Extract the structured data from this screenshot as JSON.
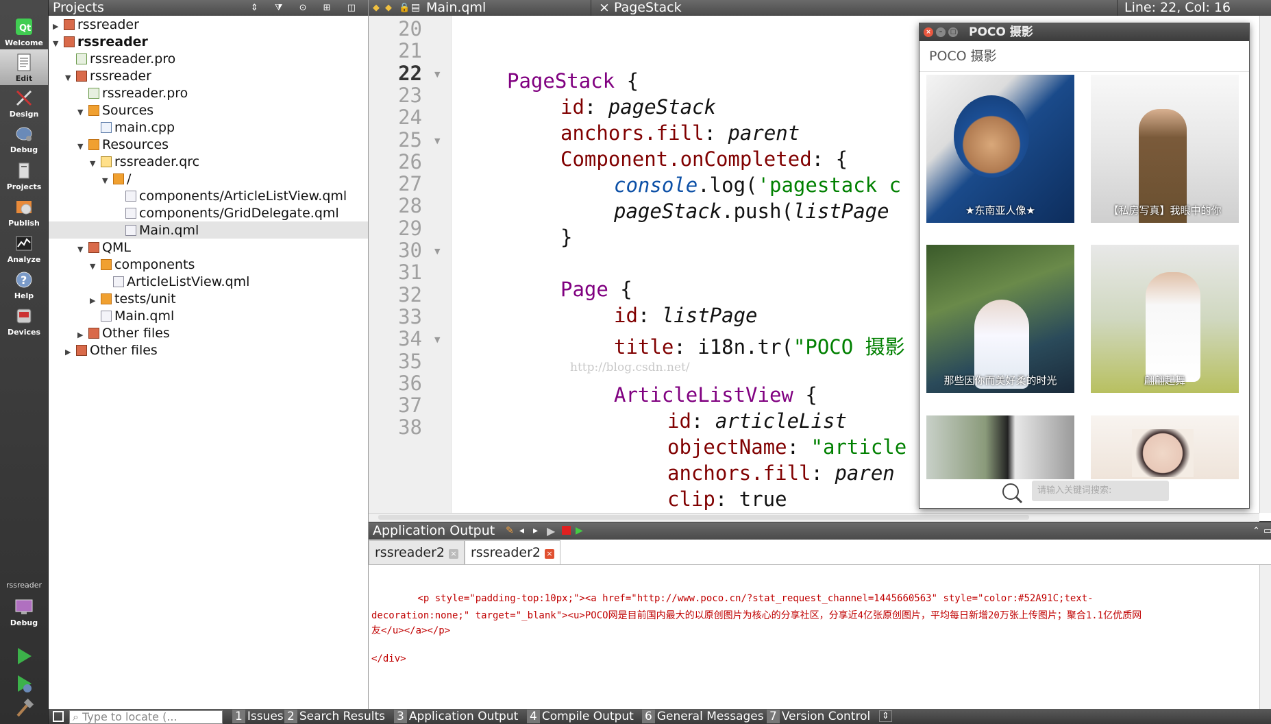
{
  "mode_bar": {
    "items": [
      {
        "label": "Welcome",
        "icon": "qt-logo-icon"
      },
      {
        "label": "Edit",
        "icon": "edit-icon"
      },
      {
        "label": "Design",
        "icon": "design-icon"
      },
      {
        "label": "Debug",
        "icon": "debug-icon"
      },
      {
        "label": "Projects",
        "icon": "projects-icon"
      },
      {
        "label": "Publish",
        "icon": "publish-icon"
      },
      {
        "label": "Analyze",
        "icon": "analyze-icon"
      },
      {
        "label": "Help",
        "icon": "help-icon"
      },
      {
        "label": "Devices",
        "icon": "devices-icon"
      }
    ],
    "target_project": "rssreader",
    "target_mode": "Debug"
  },
  "projects_pane": {
    "title": "Projects",
    "tree": [
      {
        "label": "rssreader",
        "type": "proj"
      },
      {
        "label": "rssreader",
        "type": "proj"
      },
      {
        "label": "rssreader.pro",
        "type": "pro"
      },
      {
        "label": "rssreader",
        "type": "proj"
      },
      {
        "label": "rssreader.pro",
        "type": "pro"
      },
      {
        "label": "Sources",
        "type": "folder"
      },
      {
        "label": "main.cpp",
        "type": "cpp"
      },
      {
        "label": "Resources",
        "type": "folder"
      },
      {
        "label": "rssreader.qrc",
        "type": "res"
      },
      {
        "label": "/",
        "type": "folder"
      },
      {
        "label": "components/ArticleListView.qml",
        "type": "qml"
      },
      {
        "label": "components/GridDelegate.qml",
        "type": "qml"
      },
      {
        "label": "Main.qml",
        "type": "qml"
      },
      {
        "label": "QML",
        "type": "proj"
      },
      {
        "label": "components",
        "type": "folder"
      },
      {
        "label": "ArticleListView.qml",
        "type": "qml"
      },
      {
        "label": "tests/unit",
        "type": "folder"
      },
      {
        "label": "Main.qml",
        "type": "qml"
      },
      {
        "label": "Other files",
        "type": "proj"
      },
      {
        "label": "Other files",
        "type": "proj"
      }
    ]
  },
  "editor": {
    "file_name": "Main.qml",
    "symbol": "PageStack",
    "cursor": "Line: 22, Col: 16",
    "line_numbers": [
      "20",
      "21",
      "22",
      "23",
      "24",
      "25",
      "26",
      "27",
      "28",
      "29",
      "30",
      "31",
      "32",
      "33",
      "34",
      "35",
      "36",
      "37",
      "38"
    ],
    "code": {
      "l22_kw": "PageStack",
      "l22_rest": " {",
      "l23_prop": "id",
      "l23_val": "pageStack",
      "l24_prop": "anchors.fill",
      "l24_val": "parent",
      "l25_prop": "Component.onCompleted",
      "l25_rest": ": {",
      "l26_obj": "console",
      "l26_call": ".log(",
      "l26_str": "'pagestack c",
      "l27_val": "pageStack",
      "l27_call": ".push(",
      "l27_arg": "listPage",
      "l28": "}",
      "l30_kw": "Page",
      "l30_rest": " {",
      "l31_prop": "id",
      "l31_val": "listPage",
      "l32_prop": "title",
      "l32_call": ": i18n.tr(",
      "l32_str": "\"POCO 摄影",
      "l33_watermark": "http://blog.csdn.net/",
      "l34_kw": "ArticleListView",
      "l34_rest": " {",
      "l35_prop": "id",
      "l35_val": "articleList",
      "l36_prop": "objectName",
      "l36_str": "\"article",
      "l37_prop": "anchors.fill",
      "l37_val": "paren",
      "l38_prop": "clip",
      "l38_val": "true",
      "colon": ": "
    }
  },
  "poco_window": {
    "title": "POCO 摄影",
    "header": "POCO 摄影",
    "tiles": [
      {
        "caption": "★东南亚人像★"
      },
      {
        "caption": "【私房写真】我眼中的你"
      },
      {
        "caption": "那些因你而美好柔的时光"
      },
      {
        "caption": "翩翩起舞"
      },
      {
        "caption": ""
      },
      {
        "caption": ""
      }
    ],
    "search_placeholder": "请输入关键词搜索:"
  },
  "output": {
    "title": "Application Output",
    "tabs": [
      {
        "label": "rssreader2"
      },
      {
        "label": "rssreader2"
      }
    ],
    "lines": [
      "        <p style=\"padding-top:10px;\"><a href=\"http://www.poco.cn/?stat_request_channel=1445660563\" style=\"color:#52A91C;text-",
      "decoration:none;\" target=\"_blank\"><u>POCO网是目前国内最大的以原创图片为核心的分享社区，分享近4亿张原创图片，平均每日新增20万张上传图片；聚合1.1亿优质网",
      "友</u></a></p>",
      "",
      "</div>"
    ]
  },
  "status_bar": {
    "locate_placeholder": "Type to locate (...",
    "panes": [
      {
        "num": "1",
        "label": "Issues"
      },
      {
        "num": "2",
        "label": "Search Results"
      },
      {
        "num": "3",
        "label": "Application Output"
      },
      {
        "num": "4",
        "label": "Compile Output"
      },
      {
        "num": "6",
        "label": "General Messages"
      },
      {
        "num": "7",
        "label": "Version Control"
      }
    ]
  }
}
